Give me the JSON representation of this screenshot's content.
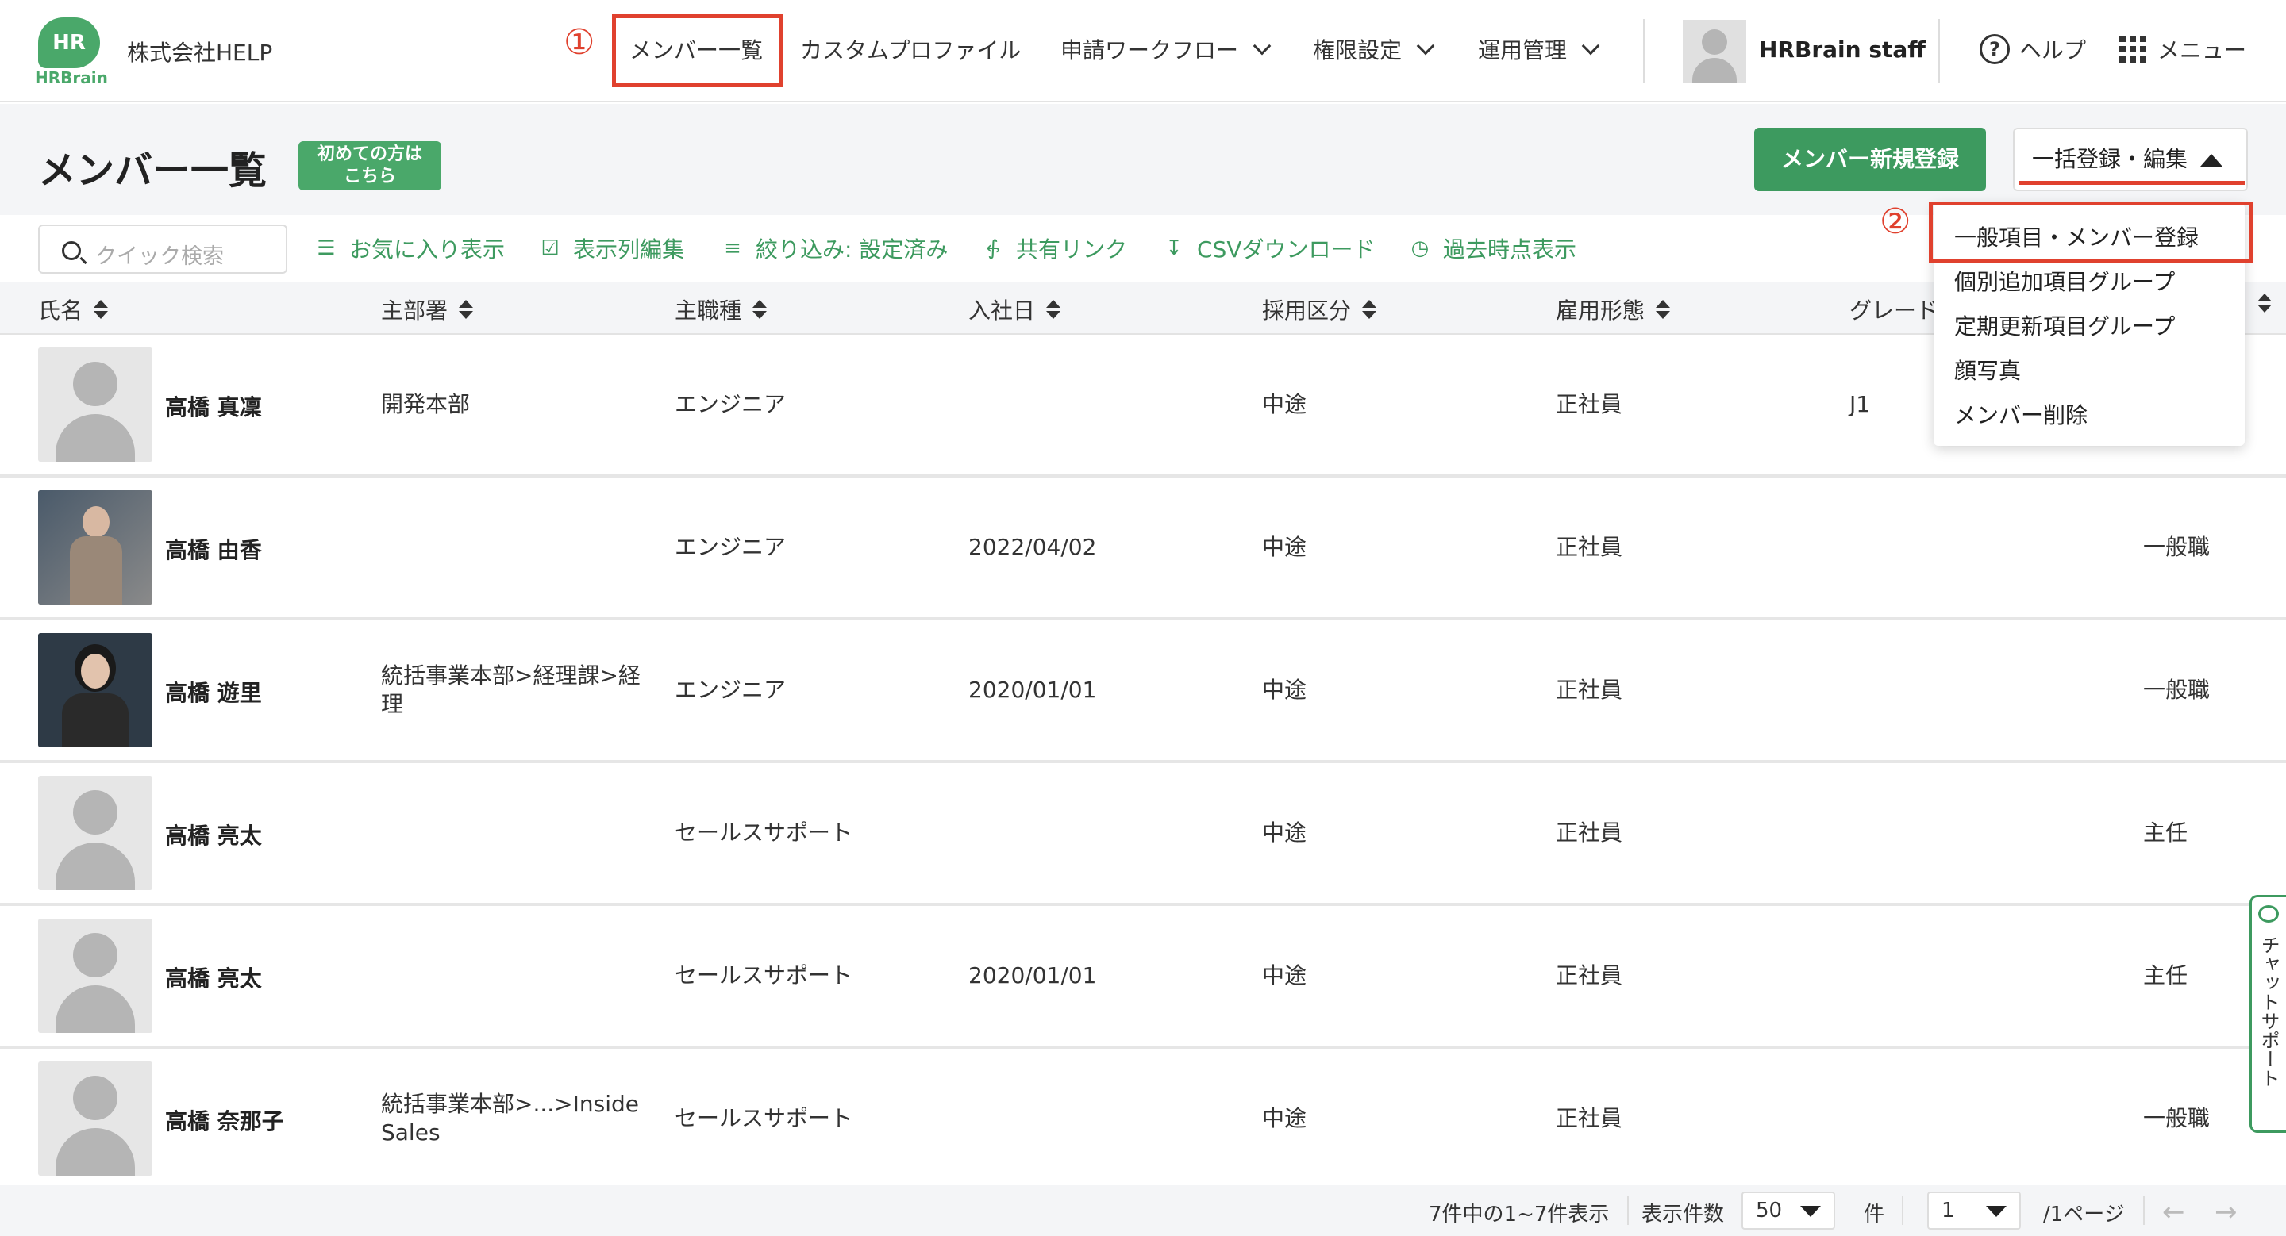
{
  "header": {
    "logo_text": "HR",
    "logo_sub": "HRBrain",
    "company": "株式会社HELP",
    "nav": [
      {
        "label": "メンバー一覧"
      },
      {
        "label": "カスタムプロファイル"
      },
      {
        "label": "申請ワークフロー"
      },
      {
        "label": "権限設定"
      },
      {
        "label": "運用管理"
      }
    ],
    "user": "HRBrain staff",
    "help": "ヘルプ",
    "menu": "メニュー"
  },
  "annotations": {
    "step1": "①",
    "step2": "②"
  },
  "page": {
    "title": "メンバー一覧",
    "beginner_line1": "初めての方は",
    "beginner_line2": "こちら",
    "new_member": "メンバー新規登録",
    "bulk_edit": "一括登録・編集"
  },
  "toolbar": {
    "search_placeholder": "クイック検索",
    "favorites": "お気に入り表示",
    "columns": "表示列編集",
    "filter": "絞り込み: 設定済み",
    "share": "共有リンク",
    "csv": "CSVダウンロード",
    "history": "過去時点表示"
  },
  "table": {
    "headers": [
      "氏名",
      "主部署",
      "主職種",
      "入社日",
      "採用区分",
      "雇用形態",
      "グレード"
    ],
    "rows": [
      {
        "name": "高橋 真凜",
        "dept": "開発本部",
        "job": "エンジニア",
        "date": "",
        "hire": "中途",
        "emp": "正社員",
        "grade": "J1",
        "title": ""
      },
      {
        "name": "高橋 由香",
        "dept": "",
        "job": "エンジニア",
        "date": "2022/04/02",
        "hire": "中途",
        "emp": "正社員",
        "grade": "",
        "title": "一般職"
      },
      {
        "name": "高橋 遊里",
        "dept": "統括事業本部>経理課>経理",
        "job": "エンジニア",
        "date": "2020/01/01",
        "hire": "中途",
        "emp": "正社員",
        "grade": "",
        "title": "一般職"
      },
      {
        "name": "高橋 亮太",
        "dept": "",
        "job": "セールスサポート",
        "date": "",
        "hire": "中途",
        "emp": "正社員",
        "grade": "",
        "title": "主任"
      },
      {
        "name": "高橋 亮太",
        "dept": "",
        "job": "セールスサポート",
        "date": "2020/01/01",
        "hire": "中途",
        "emp": "正社員",
        "grade": "",
        "title": "主任"
      },
      {
        "name": "高橋 奈那子",
        "dept": "統括事業本部>...>Inside Sales",
        "job": "セールスサポート",
        "date": "",
        "hire": "中途",
        "emp": "正社員",
        "grade": "",
        "title": "一般職"
      }
    ]
  },
  "dropdown": {
    "items": [
      "一般項目・メンバー登録",
      "個別追加項目グループ",
      "定期更新項目グループ",
      "顔写真",
      "メンバー削除"
    ]
  },
  "footer": {
    "summary": "7件中の1~7件表示",
    "per_page_label": "表示件数",
    "per_page_value": "50",
    "per_page_unit": "件",
    "page_value": "1",
    "page_total": "/1ページ",
    "prev": "←",
    "next": "→"
  },
  "chat": {
    "label": "チャットサポート"
  },
  "colors": {
    "brand_green": "#3d9a5f",
    "highlight_red": "#e0412e"
  }
}
